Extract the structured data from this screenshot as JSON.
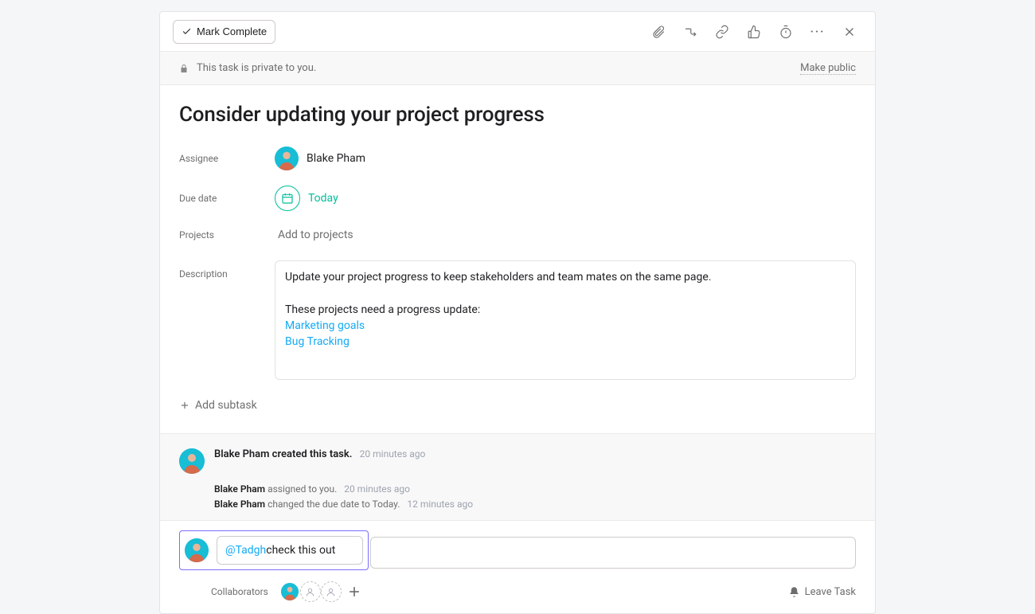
{
  "toolbar": {
    "mark_complete": "Mark Complete"
  },
  "privacy": {
    "message": "This task is private to you.",
    "make_public": "Make public"
  },
  "task": {
    "title": "Consider updating your project progress"
  },
  "labels": {
    "assignee": "Assignee",
    "due_date": "Due date",
    "projects": "Projects",
    "description": "Description",
    "add_projects": "Add to projects",
    "add_subtask": "Add subtask",
    "collaborators": "Collaborators",
    "leave_task": "Leave Task"
  },
  "assignee": {
    "name": "Blake Pham"
  },
  "due_date": {
    "display": "Today"
  },
  "description": {
    "line1": "Update your project progress to keep stakeholders and team mates on the same page.",
    "line2": "These projects need a progress update:",
    "links": [
      "Marketing goals",
      "Bug Tracking"
    ]
  },
  "activity": {
    "created_actor": "Blake Pham",
    "created_text": " created this task.",
    "created_time": "20 minutes ago",
    "events": [
      {
        "actor": "Blake Pham",
        "text": " assigned to you.",
        "time": "20 minutes ago"
      },
      {
        "actor": "Blake Pham",
        "text": " changed the due date to Today.",
        "time": "12 minutes ago"
      }
    ]
  },
  "comment": {
    "mention": "@Tadgh",
    "text": " check this out"
  }
}
